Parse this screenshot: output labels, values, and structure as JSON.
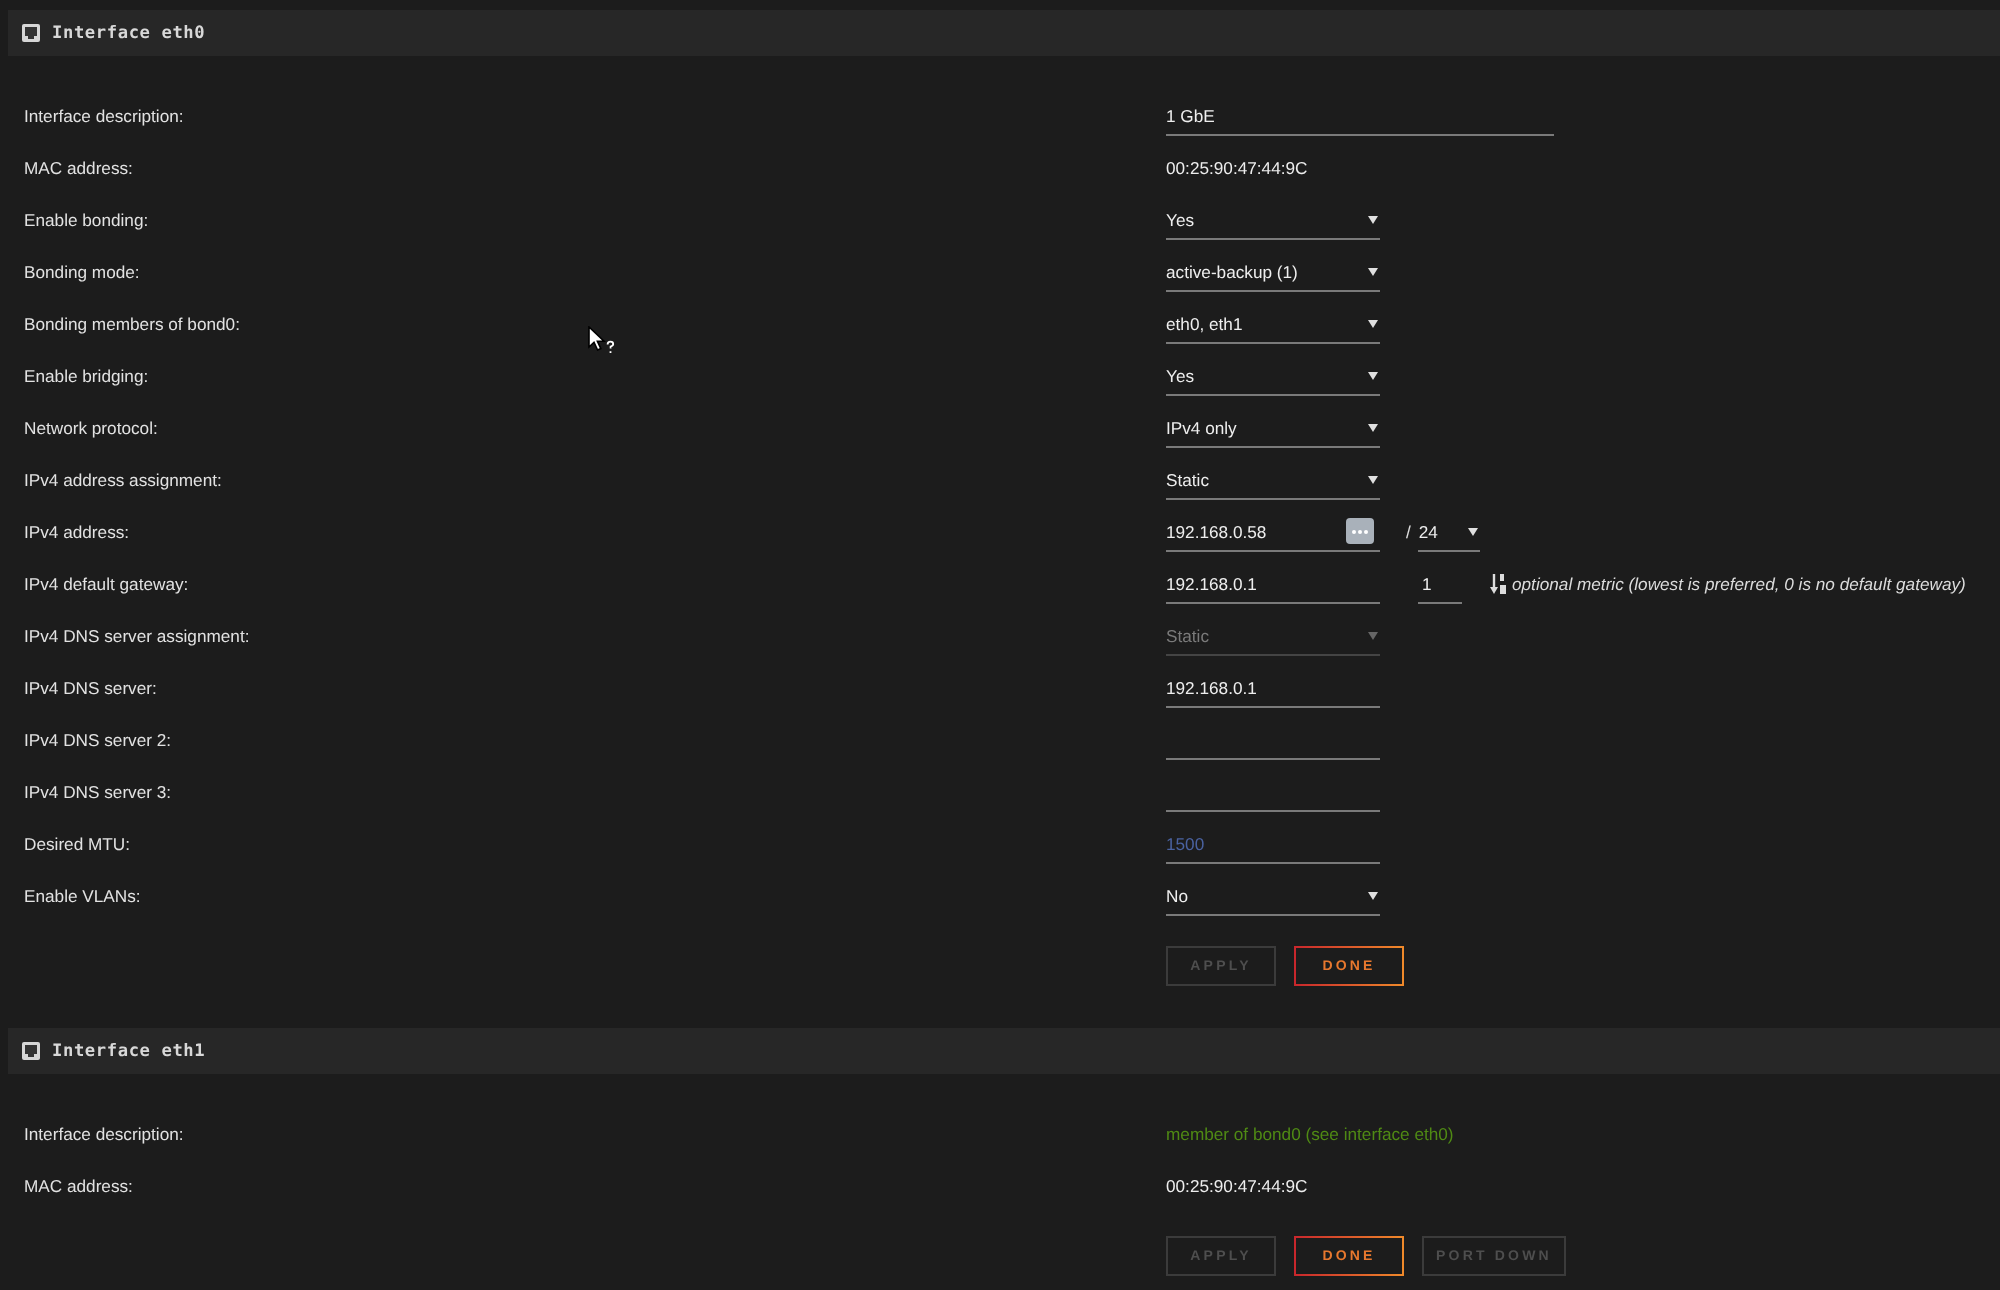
{
  "interfaces": [
    {
      "title": "Interface eth0",
      "fields": [
        {
          "label": "Interface description:",
          "kind": "text",
          "value": "1 GbE"
        },
        {
          "label": "MAC address:",
          "kind": "static",
          "value": "00:25:90:47:44:9C"
        },
        {
          "label": "Enable bonding:",
          "kind": "select",
          "value": "Yes",
          "disabled": false
        },
        {
          "label": "Bonding mode:",
          "kind": "select",
          "value": "active-backup (1)",
          "disabled": false
        },
        {
          "label": "Bonding members of bond0:",
          "kind": "select",
          "value": "eth0, eth1",
          "disabled": false
        },
        {
          "label": "Enable bridging:",
          "kind": "select",
          "value": "Yes",
          "disabled": false
        },
        {
          "label": "Network protocol:",
          "kind": "select",
          "value": "IPv4 only",
          "disabled": false
        },
        {
          "label": "IPv4 address assignment:",
          "kind": "select",
          "value": "Static",
          "disabled": false
        },
        {
          "label": "IPv4 address:",
          "kind": "address",
          "value": "192.168.0.58",
          "separator": "/",
          "prefix_length": "24"
        },
        {
          "label": "IPv4 default gateway:",
          "kind": "gateway",
          "value": "192.168.0.1",
          "metric": "1",
          "hint": "optional metric (lowest is preferred, 0 is no default gateway)"
        },
        {
          "label": "IPv4 DNS server assignment:",
          "kind": "select",
          "value": "Static",
          "disabled": true
        },
        {
          "label": "IPv4 DNS server:",
          "kind": "ip",
          "value": "192.168.0.1"
        },
        {
          "label": "IPv4 DNS server 2:",
          "kind": "ip"
        },
        {
          "label": "IPv4 DNS server 3:",
          "kind": "ip"
        },
        {
          "label": "Desired MTU:",
          "kind": "ip",
          "placeholder": "1500"
        },
        {
          "label": "Enable VLANs:",
          "kind": "select",
          "value": "No",
          "disabled": false
        }
      ],
      "buttons": [
        {
          "label": "APPLY",
          "disabled": true
        },
        {
          "label": "DONE",
          "disabled": false
        }
      ]
    },
    {
      "title": "Interface eth1",
      "fields": [
        {
          "label": "Interface description:",
          "kind": "note",
          "value": "member of bond0 (see interface eth0)"
        },
        {
          "label": "MAC address:",
          "kind": "static",
          "value": "00:25:90:47:44:9C"
        }
      ],
      "buttons": [
        {
          "label": "APPLY",
          "disabled": true
        },
        {
          "label": "DONE",
          "disabled": false
        },
        {
          "label": "PORT DOWN",
          "disabled": true
        }
      ]
    }
  ]
}
